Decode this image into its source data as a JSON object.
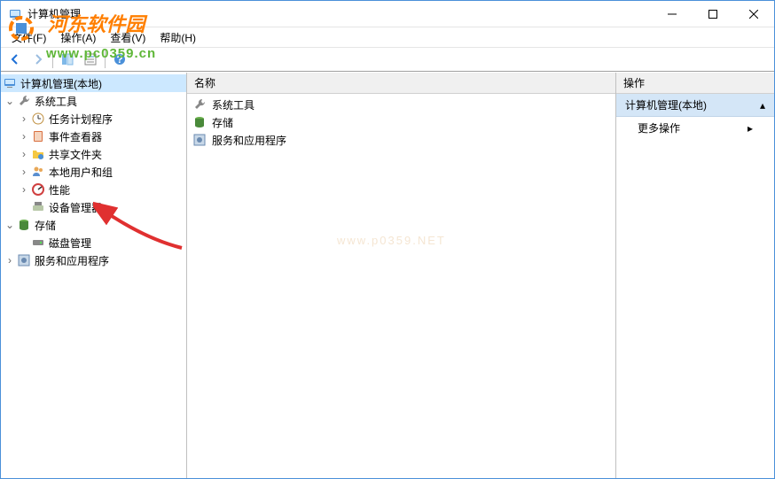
{
  "window": {
    "title": "计算机管理"
  },
  "menu": {
    "file": "文件(F)",
    "action": "操作(A)",
    "view": "查看(V)",
    "help": "帮助(H)"
  },
  "tree": {
    "root": "计算机管理(本地)",
    "system_tools": "系统工具",
    "task_scheduler": "任务计划程序",
    "event_viewer": "事件查看器",
    "shared_folders": "共享文件夹",
    "local_users": "本地用户和组",
    "performance": "性能",
    "device_manager": "设备管理器",
    "storage": "存储",
    "disk_management": "磁盘管理",
    "services_apps": "服务和应用程序"
  },
  "center": {
    "header": "名称",
    "items": {
      "system_tools": "系统工具",
      "storage": "存储",
      "services_apps": "服务和应用程序"
    }
  },
  "actions": {
    "header": "操作",
    "group": "计算机管理(本地)",
    "more": "更多操作"
  },
  "watermark": {
    "logo": "河东软件园",
    "url": "www.pc0359.cn",
    "center": "www.p0359.NET"
  }
}
